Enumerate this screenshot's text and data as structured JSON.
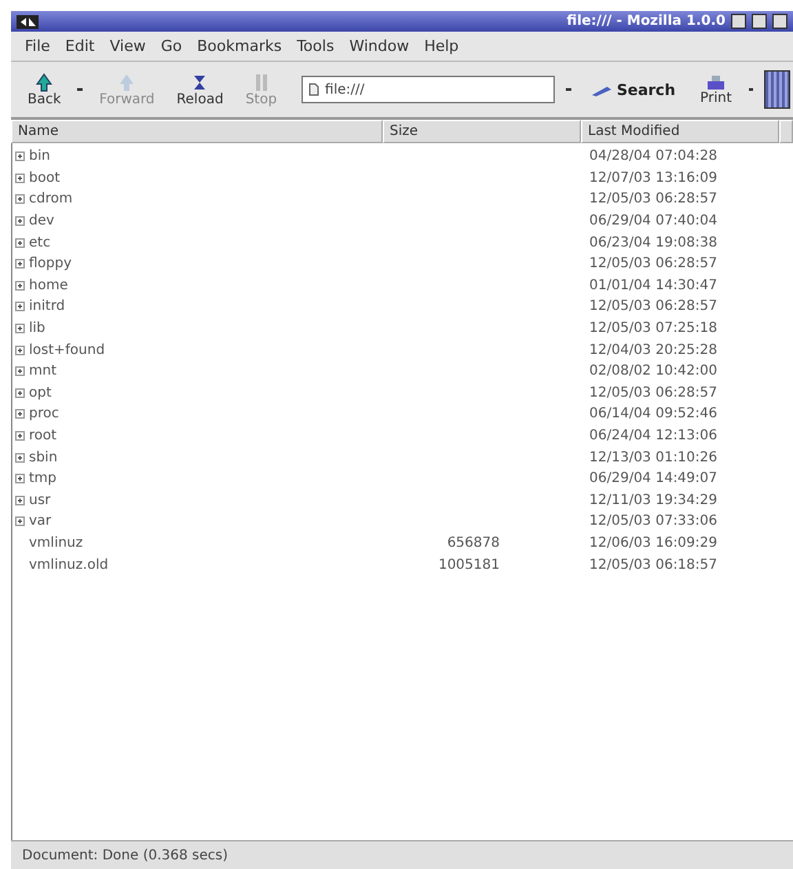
{
  "window": {
    "title": "file:/// - Mozilla 1.0.0"
  },
  "menu": [
    "File",
    "Edit",
    "View",
    "Go",
    "Bookmarks",
    "Tools",
    "Window",
    "Help"
  ],
  "toolbar": [
    {
      "kind": "back",
      "label": "Back",
      "disabled": false,
      "dropdown": true
    },
    {
      "kind": "forward",
      "label": "Forward",
      "disabled": true,
      "dropdown": false
    },
    {
      "kind": "reload",
      "label": "Reload",
      "disabled": false,
      "dropdown": false
    },
    {
      "kind": "stop",
      "label": "Stop",
      "disabled": true,
      "dropdown": false
    }
  ],
  "address": {
    "value": "file:///"
  },
  "search": {
    "label": "Search"
  },
  "print": {
    "label": "Print"
  },
  "table": {
    "columns": [
      "Name",
      "Size",
      "Last Modified"
    ],
    "rows": [
      {
        "kind": "folder",
        "name": "bin",
        "size": "",
        "modified": "04/28/04 07:04:28"
      },
      {
        "kind": "folder",
        "name": "boot",
        "size": "",
        "modified": "12/07/03 13:16:09"
      },
      {
        "kind": "folder",
        "name": "cdrom",
        "size": "",
        "modified": "12/05/03 06:28:57"
      },
      {
        "kind": "folder",
        "name": "dev",
        "size": "",
        "modified": "06/29/04 07:40:04"
      },
      {
        "kind": "folder",
        "name": "etc",
        "size": "",
        "modified": "06/23/04 19:08:38"
      },
      {
        "kind": "folder",
        "name": "floppy",
        "size": "",
        "modified": "12/05/03 06:28:57"
      },
      {
        "kind": "folder",
        "name": "home",
        "size": "",
        "modified": "01/01/04 14:30:47"
      },
      {
        "kind": "folder",
        "name": "initrd",
        "size": "",
        "modified": "12/05/03 06:28:57"
      },
      {
        "kind": "folder",
        "name": "lib",
        "size": "",
        "modified": "12/05/03 07:25:18"
      },
      {
        "kind": "folder",
        "name": "lost+found",
        "size": "",
        "modified": "12/04/03 20:25:28"
      },
      {
        "kind": "folder",
        "name": "mnt",
        "size": "",
        "modified": "02/08/02 10:42:00"
      },
      {
        "kind": "folder",
        "name": "opt",
        "size": "",
        "modified": "12/05/03 06:28:57"
      },
      {
        "kind": "folder",
        "name": "proc",
        "size": "",
        "modified": "06/14/04 09:52:46"
      },
      {
        "kind": "folder",
        "name": "root",
        "size": "",
        "modified": "06/24/04 12:13:06"
      },
      {
        "kind": "folder",
        "name": "sbin",
        "size": "",
        "modified": "12/13/03 01:10:26"
      },
      {
        "kind": "folder",
        "name": "tmp",
        "size": "",
        "modified": "06/29/04 14:49:07"
      },
      {
        "kind": "folder",
        "name": "usr",
        "size": "",
        "modified": "12/11/03 19:34:29"
      },
      {
        "kind": "folder",
        "name": "var",
        "size": "",
        "modified": "12/05/03 07:33:06"
      },
      {
        "kind": "file",
        "name": "vmlinuz",
        "size": "656878",
        "modified": "12/06/03 16:09:29"
      },
      {
        "kind": "file",
        "name": "vmlinuz.old",
        "size": "1005181",
        "modified": "12/05/03 06:18:57"
      }
    ]
  },
  "status_bar": {
    "text": "Document: Done (0.368 secs)"
  }
}
